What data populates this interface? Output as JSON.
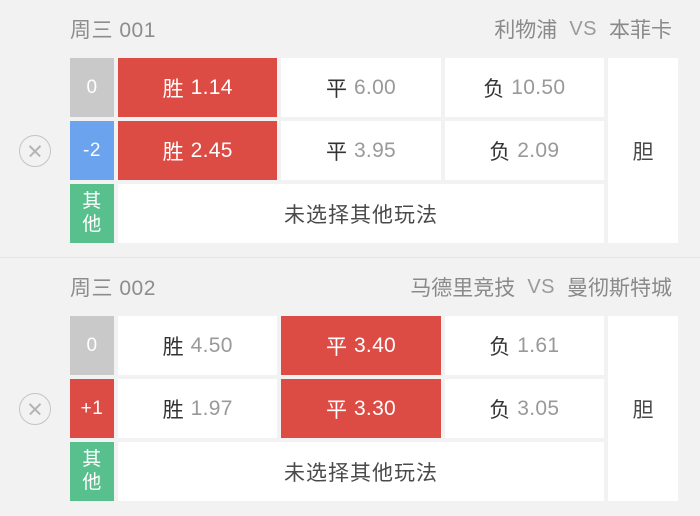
{
  "page": {
    "background": "#f2f2f2",
    "accent_selected": "#dc4b44",
    "badge_colors": {
      "zero": "#c9c9c9",
      "negative": "#6ba3ef",
      "positive": "#dc4b44",
      "other": "#58c08c"
    }
  },
  "common": {
    "vs_label": "VS",
    "dan_label": "胆",
    "other_badge_line1": "其",
    "other_badge_line2": "他",
    "other_empty_text": "未选择其他玩法",
    "close_icon": "close-circle-icon"
  },
  "matches": [
    {
      "match_id": "周三 001",
      "home_team": "利物浦",
      "away_team": "本菲卡",
      "rows": [
        {
          "handicap": "0",
          "handicap_style": "gray",
          "cells": [
            {
              "label": "胜",
              "value": "1.14",
              "selected": true
            },
            {
              "label": "平",
              "value": "6.00",
              "selected": false
            },
            {
              "label": "负",
              "value": "10.50",
              "selected": false
            }
          ]
        },
        {
          "handicap": "-2",
          "handicap_style": "blue",
          "cells": [
            {
              "label": "胜",
              "value": "2.45",
              "selected": true
            },
            {
              "label": "平",
              "value": "3.95",
              "selected": false
            },
            {
              "label": "负",
              "value": "2.09",
              "selected": false
            }
          ]
        }
      ]
    },
    {
      "match_id": "周三 002",
      "home_team": "马德里竞技",
      "away_team": "曼彻斯特城",
      "rows": [
        {
          "handicap": "0",
          "handicap_style": "gray",
          "cells": [
            {
              "label": "胜",
              "value": "4.50",
              "selected": false
            },
            {
              "label": "平",
              "value": "3.40",
              "selected": true
            },
            {
              "label": "负",
              "value": "1.61",
              "selected": false
            }
          ]
        },
        {
          "handicap": "+1",
          "handicap_style": "red",
          "cells": [
            {
              "label": "胜",
              "value": "1.97",
              "selected": false
            },
            {
              "label": "平",
              "value": "3.30",
              "selected": true
            },
            {
              "label": "负",
              "value": "3.05",
              "selected": false
            }
          ]
        }
      ]
    }
  ]
}
